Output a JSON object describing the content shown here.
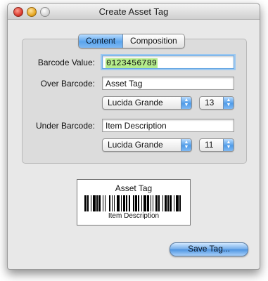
{
  "window": {
    "title": "Create Asset Tag"
  },
  "tabs": [
    {
      "label": "Content",
      "selected": true
    },
    {
      "label": "Composition",
      "selected": false
    }
  ],
  "form": {
    "barcode_value_label": "Barcode Value:",
    "barcode_value": "0123456789",
    "over_barcode_label": "Over Barcode:",
    "over_barcode_value": "Asset Tag",
    "over_font": "Lucida Grande",
    "over_size": "13",
    "under_barcode_label": "Under Barcode:",
    "under_barcode_value": "Item Description",
    "under_font": "Lucida Grande",
    "under_size": "11"
  },
  "preview": {
    "top_text": "Asset Tag",
    "bottom_text": "Item Description"
  },
  "actions": {
    "save_label": "Save Tag..."
  },
  "colors": {
    "accent": "#5aa4ec",
    "selection": "#b5ec8c"
  }
}
